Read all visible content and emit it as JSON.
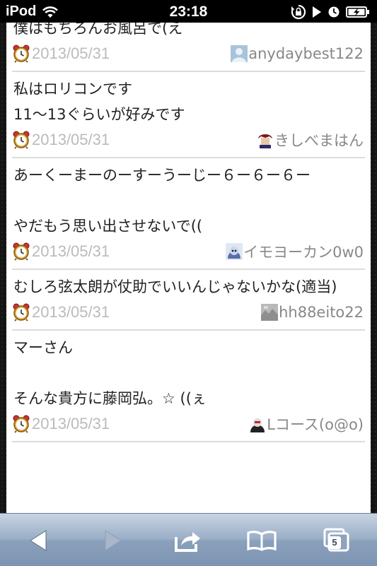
{
  "status_bar": {
    "carrier": "iPod",
    "time": "23:18",
    "icons": [
      "wifi-icon",
      "rotation-lock-icon",
      "play-icon",
      "alarm-icon",
      "battery-charging-icon"
    ]
  },
  "comments": [
    {
      "text": "僕はもちろんお風呂で(え",
      "date": "2013/05/31",
      "author": "anydaybest122",
      "avatar": "default-avatar"
    },
    {
      "text": "私はロリコンです\n11〜13ぐらいが好みです",
      "date": "2013/05/31",
      "author": "きしべまはん",
      "avatar": "character-avatar"
    },
    {
      "text": "あーくーまーのーすーうーじー６ー６ー６ー\n\nやだもう思い出させないで((",
      "date": "2013/05/31",
      "author": "イモヨーカン0w0",
      "avatar": "anime-avatar"
    },
    {
      "text": "むしろ弦太朗が仗助でいいんじゃないかな(適当)",
      "date": "2013/05/31",
      "author": "hh88eito22",
      "avatar": "photo-avatar"
    },
    {
      "text": "マーさん\n\nそんな貴方に藤岡弘。☆ ((ぇ",
      "date": "2013/05/31",
      "author": "Lコース(o@o)",
      "avatar": "character-avatar-2"
    }
  ],
  "toolbar": {
    "tab_count": "5",
    "buttons": [
      "back-icon",
      "forward-icon",
      "share-icon",
      "bookmarks-icon",
      "tabs-icon"
    ]
  }
}
